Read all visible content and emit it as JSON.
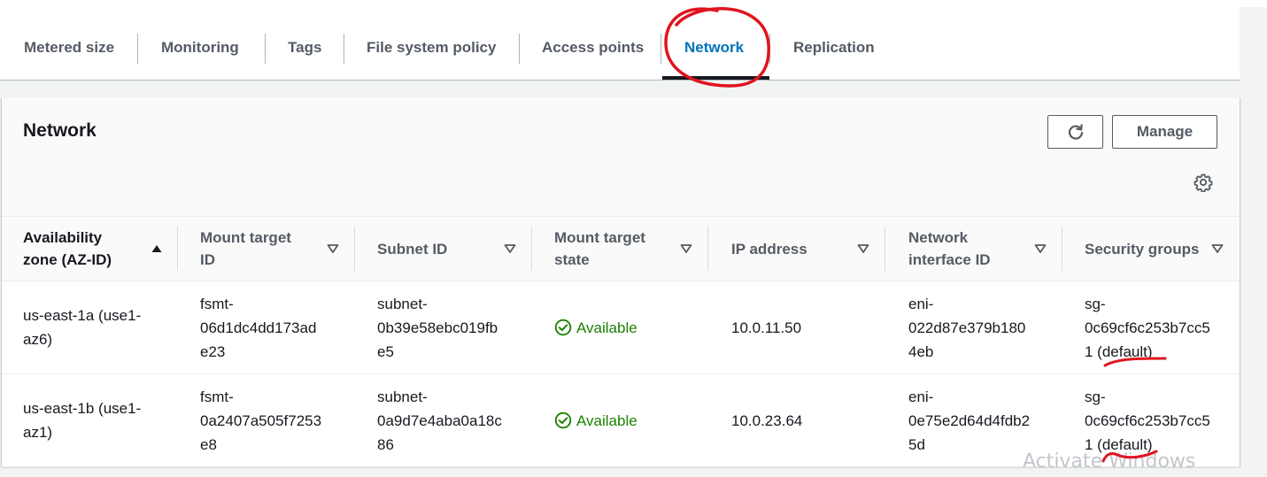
{
  "tabs": [
    {
      "label": "Metered size"
    },
    {
      "label": "Monitoring"
    },
    {
      "label": "Tags"
    },
    {
      "label": "File system policy"
    },
    {
      "label": "Access points"
    },
    {
      "label": "Network",
      "active": true
    },
    {
      "label": "Replication"
    }
  ],
  "panel": {
    "title": "Network",
    "manage_label": "Manage",
    "refresh_icon": "refresh-icon",
    "settings_icon": "gear-icon"
  },
  "table": {
    "columns": [
      {
        "line1": "Availability",
        "line2": "zone (AZ-ID)",
        "sort": "ascending"
      },
      {
        "line1": "Mount target",
        "line2": "ID",
        "sort": "none"
      },
      {
        "line1": "Subnet ID",
        "line2": "",
        "sort": "none"
      },
      {
        "line1": "Mount target",
        "line2": "state",
        "sort": "none"
      },
      {
        "line1": "IP address",
        "line2": "",
        "sort": "none"
      },
      {
        "line1": "Network",
        "line2": "interface ID",
        "sort": "none"
      },
      {
        "line1": "Security groups",
        "line2": "",
        "sort": "none"
      }
    ],
    "rows": [
      {
        "az": [
          "us-east-1a (use1-",
          "az6)"
        ],
        "mount_target_id": [
          "fsmt-",
          "06d1dc4dd173ad",
          "e23"
        ],
        "subnet_id": [
          "subnet-",
          "0b39e58ebc019fb",
          "e5"
        ],
        "state": "Available",
        "ip": "10.0.11.50",
        "eni": [
          "eni-",
          "022d87e379b180",
          "4eb"
        ],
        "sg": [
          "sg-",
          "0c69cf6c253b7cc5",
          "1 (default)"
        ]
      },
      {
        "az": [
          "us-east-1b (use1-",
          "az1)"
        ],
        "mount_target_id": [
          "fsmt-",
          "0a2407a505f7253",
          "e8"
        ],
        "subnet_id": [
          "subnet-",
          "0a9d7e4aba0a18c",
          "86"
        ],
        "state": "Available",
        "ip": "10.0.23.64",
        "eni": [
          "eni-",
          "0e75e2d64d4fdb2",
          "5d"
        ],
        "sg": [
          "sg-",
          "0c69cf6c253b7cc5",
          "1 (default)"
        ]
      }
    ]
  },
  "watermark": "Activate Windows",
  "colors": {
    "active_tab": "#0073bb",
    "status_available": "#1d8102",
    "annotation": "#e0141e"
  }
}
